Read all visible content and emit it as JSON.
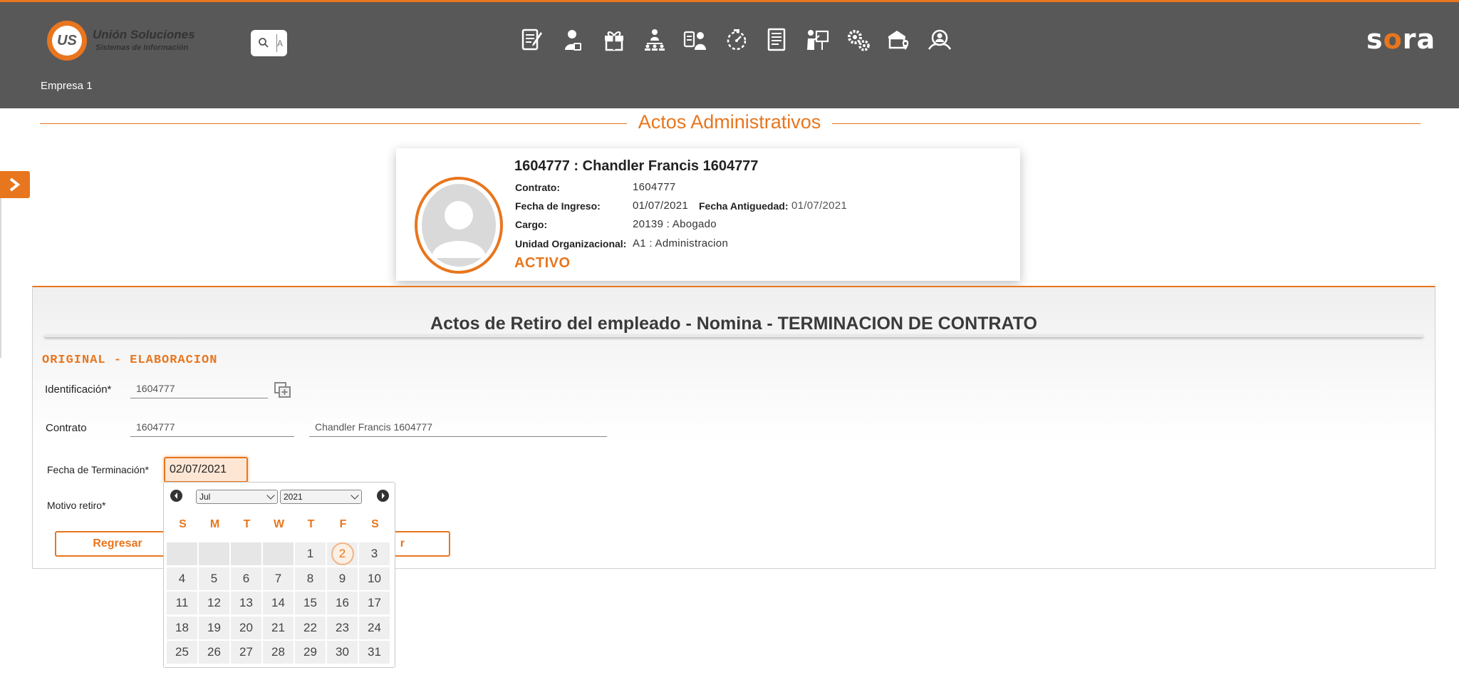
{
  "header": {
    "logo_badge": "US",
    "logo_title": "Unión Soluciones",
    "logo_subtitle": "Sistemas de Información",
    "search_placeholder": "A",
    "brand": "sora",
    "company": "Empresa 1",
    "nav_icons": [
      "document-edit-icon",
      "employee-icon",
      "gift-icon",
      "org-chart-icon",
      "id-card-user-icon",
      "timer-icon",
      "report-list-icon",
      "training-board-icon",
      "settings-gears-icon",
      "health-location-icon",
      "user-search-icon"
    ]
  },
  "page": {
    "title": "Actos Administrativos"
  },
  "employee": {
    "name": "1604777 : Chandler Francis 1604777",
    "contrato_label": "Contrato:",
    "contrato_value": "1604777",
    "fecha_ingreso_label": "Fecha de Ingreso:",
    "fecha_ingreso_value": "01/07/2021",
    "fecha_antiguedad_label": "Fecha Antiguedad:",
    "fecha_antiguedad_value": "01/07/2021",
    "cargo_label": "Cargo:",
    "cargo_value": "20139 : Abogado",
    "unidad_label": "Unidad Organizacional:",
    "unidad_value": "A1 : Administracion",
    "status": "ACTIVO"
  },
  "form": {
    "title": "Actos de Retiro del empleado - Nomina - TERMINACION DE CONTRATO",
    "subtitle": "ORIGINAL - ELABORACION",
    "identificacion_label": "Identificación*",
    "identificacion_value": "1604777",
    "contrato_label": "Contrato",
    "contrato_value": "1604777",
    "contrato_name_value": "Chandler Francis 1604777",
    "fecha_label": "Fecha de Terminación*",
    "fecha_value": "02/07/2021",
    "motivo_label": "Motivo retiro*",
    "regresar_label": "Regresar",
    "second_button_fragment": "r"
  },
  "datepicker": {
    "month": "Jul",
    "year": "2021",
    "dows": [
      "S",
      "M",
      "T",
      "W",
      "T",
      "F",
      "S"
    ],
    "leading_empty": 4,
    "days": [
      "1",
      "2",
      "3",
      "4",
      "5",
      "6",
      "7",
      "8",
      "9",
      "10",
      "11",
      "12",
      "13",
      "14",
      "15",
      "16",
      "17",
      "18",
      "19",
      "20",
      "21",
      "22",
      "23",
      "24",
      "25",
      "26",
      "27",
      "28",
      "29",
      "30",
      "31"
    ],
    "selected": "2"
  }
}
